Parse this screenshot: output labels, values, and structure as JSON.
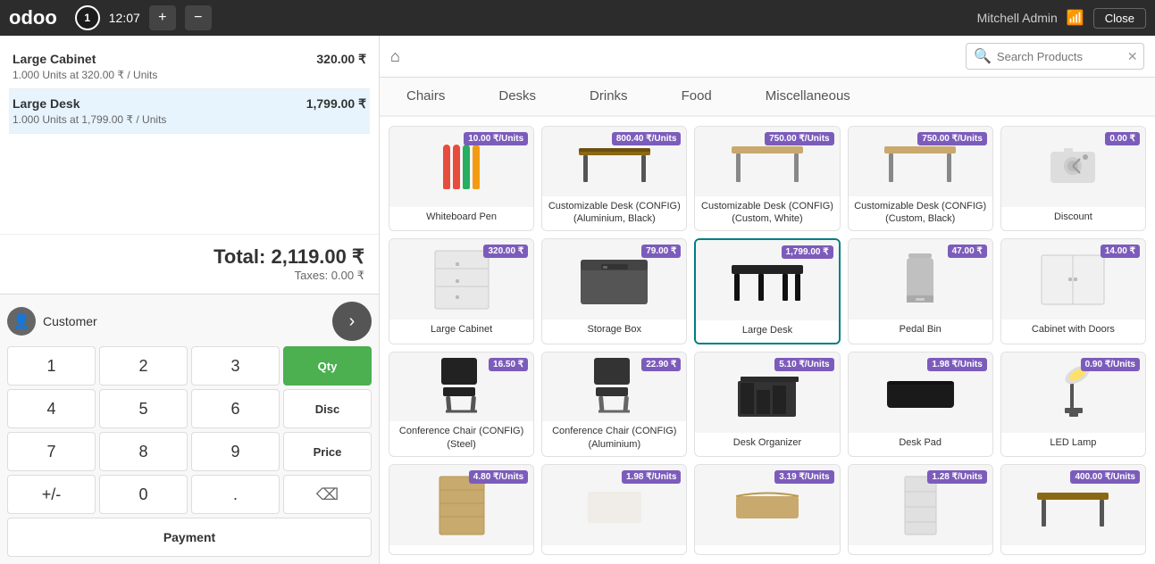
{
  "topbar": {
    "logo": "odoo",
    "session_number": "1",
    "time": "12:07",
    "add_label": "+",
    "minus_label": "−",
    "admin_name": "Mitchell Admin",
    "wifi": "wifi",
    "close_label": "Close"
  },
  "order": {
    "items": [
      {
        "name": "Large Cabinet",
        "price": "320.00 ₹",
        "detail": "1.000 Units at 320.00 ₹ / Units"
      },
      {
        "name": "Large Desk",
        "price": "1,799.00 ₹",
        "detail": "1.000 Units at 1,799.00 ₹ / Units"
      }
    ],
    "total_label": "Total:",
    "total": "2,119.00 ₹",
    "tax_label": "Taxes: 0.00 ₹"
  },
  "numpad": {
    "customer_label": "Customer",
    "buttons": [
      "1",
      "2",
      "3",
      "4",
      "5",
      "6",
      "7",
      "8",
      "9",
      "+/-",
      "0",
      "."
    ],
    "qty_label": "Qty",
    "disc_label": "Disc",
    "price_label": "Price",
    "payment_label": "Payment"
  },
  "search": {
    "placeholder": "Search Products"
  },
  "categories": [
    {
      "label": "Chairs",
      "active": false
    },
    {
      "label": "Desks",
      "active": false
    },
    {
      "label": "Drinks",
      "active": false
    },
    {
      "label": "Food",
      "active": false
    },
    {
      "label": "Miscellaneous",
      "active": false
    }
  ],
  "products": [
    {
      "name": "Whiteboard Pen",
      "price": "10.00 ₹/Units",
      "type": "pen"
    },
    {
      "name": "Customizable Desk (CONFIG) (Aluminium, Black)",
      "price": "800.40 ₹/Units",
      "type": "desk"
    },
    {
      "name": "Customizable Desk (CONFIG) (Custom, White)",
      "price": "750.00 ₹/Units",
      "type": "desk"
    },
    {
      "name": "Customizable Desk (CONFIG) (Custom, Black)",
      "price": "750.00 ₹/Units",
      "type": "desk"
    },
    {
      "name": "Discount",
      "price": "0.00 ₹",
      "type": "camera"
    },
    {
      "name": "Large Cabinet",
      "price": "320.00 ₹",
      "type": "cabinet"
    },
    {
      "name": "Storage Box",
      "price": "79.00 ₹",
      "type": "box"
    },
    {
      "name": "Large Desk",
      "price": "1,799.00 ₹",
      "type": "largedesk",
      "selected": true
    },
    {
      "name": "Pedal Bin",
      "price": "47.00 ₹",
      "type": "bin"
    },
    {
      "name": "Cabinet with Doors",
      "price": "14.00 ₹",
      "type": "cabdoors"
    },
    {
      "name": "Conference Chair (CONFIG) (Steel)",
      "price": "16.50 ₹",
      "type": "chair"
    },
    {
      "name": "Conference Chair (CONFIG) (Aluminium)",
      "price": "22.90 ₹",
      "type": "chair"
    },
    {
      "name": "Desk Organizer",
      "price": "5.10 ₹/Units",
      "type": "organizer"
    },
    {
      "name": "Desk Pad",
      "price": "1.98 ₹/Units",
      "type": "deskpad"
    },
    {
      "name": "LED Lamp",
      "price": "0.90 ₹/Units",
      "type": "lamp"
    },
    {
      "name": "",
      "price": "4.80 ₹/Units",
      "type": "shelf2"
    },
    {
      "name": "",
      "price": "1.98 ₹/Units",
      "type": "blank"
    },
    {
      "name": "",
      "price": "3.19 ₹/Units",
      "type": "rug"
    },
    {
      "name": "",
      "price": "1.28 ₹/Units",
      "type": "shelf3"
    },
    {
      "name": "",
      "price": "400.00 ₹/Units",
      "type": "desk2"
    }
  ]
}
